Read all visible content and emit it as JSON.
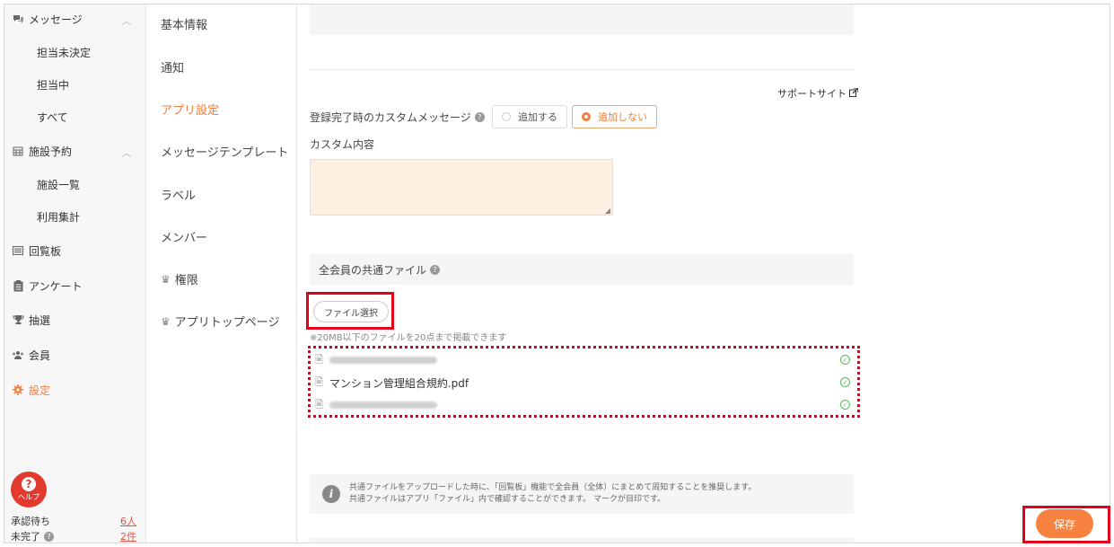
{
  "sidebar": {
    "messages": {
      "label": "メッセージ",
      "icon": "chat-icon"
    },
    "messages_sub": [
      "担当未決定",
      "担当中",
      "すべて"
    ],
    "facility": {
      "label": "施設予約",
      "icon": "calendar-icon"
    },
    "facility_sub": [
      "施設一覧",
      "利用集計"
    ],
    "circular": {
      "label": "回覧板",
      "icon": "board-icon"
    },
    "survey": {
      "label": "アンケート",
      "icon": "clipboard-icon"
    },
    "lottery": {
      "label": "抽選",
      "icon": "trophy-icon"
    },
    "members": {
      "label": "会員",
      "icon": "people-icon"
    },
    "settings": {
      "label": "設定",
      "icon": "gear-icon"
    },
    "help": {
      "label": "ヘルプ"
    },
    "stats": [
      {
        "label": "承認待ち",
        "value": "6人"
      },
      {
        "label": "未完了",
        "value": "2件"
      }
    ]
  },
  "menu": {
    "items": [
      "基本情報",
      "通知",
      "アプリ設定",
      "メッセージテンプレート",
      "ラベル",
      "メンバー",
      "権限",
      "アプリトップページ"
    ],
    "active": "アプリ設定"
  },
  "main": {
    "support_link": "サポートサイト",
    "custom_message_label": "登録完了時のカスタムメッセージ",
    "radio_add": "追加する",
    "radio_no_add": "追加しない",
    "custom_content_label": "カスタム内容",
    "shared_files_label": "全会員の共通ファイル",
    "file_select_button": "ファイル選択",
    "file_note": "※20MB以下のファイルを20点まで掲載できます",
    "files": [
      "",
      "マンション管理組合規約.pdf",
      ""
    ],
    "info_line1": "共通ファイルをアップロードした時に、「回覧板」機能で全会員（全体）にまとめて周知することを推奨します。",
    "info_line2": "共通ファイルはアプリ「ファイル」内で確認することができます。 マークが目印です。",
    "save_button": "保存"
  },
  "colors": {
    "accent": "#f07e3d",
    "save": "#f7823f",
    "highlight": "#e0001b",
    "help": "#e23a2e"
  }
}
